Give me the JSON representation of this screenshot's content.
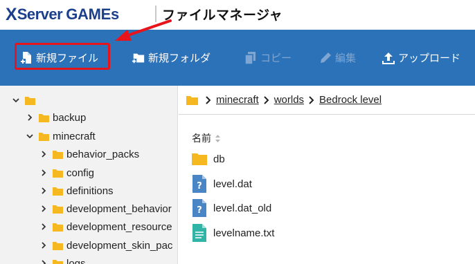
{
  "header": {
    "logo_x": "X",
    "logo_server": "Server",
    "logo_games": "GAMEs",
    "app_title": "ファイルマネージャ"
  },
  "toolbar": {
    "new_file": "新規ファイル",
    "new_folder": "新規フォルダ",
    "copy": "コピー",
    "edit": "編集",
    "upload": "アップロード"
  },
  "colors": {
    "brand": "#1c3f8c",
    "toolbar_bg": "#2c72b8",
    "highlight": "#e8141c",
    "folder": "#f5b820"
  },
  "tree": {
    "root_label": "",
    "items": [
      {
        "label": "backup",
        "expanded": false
      },
      {
        "label": "minecraft",
        "expanded": true
      },
      {
        "label": "behavior_packs",
        "expanded": false
      },
      {
        "label": "config",
        "expanded": false
      },
      {
        "label": "definitions",
        "expanded": false
      },
      {
        "label": "development_behavior",
        "expanded": false
      },
      {
        "label": "development_resource",
        "expanded": false
      },
      {
        "label": "development_skin_pac",
        "expanded": false
      },
      {
        "label": "logs",
        "expanded": false
      }
    ]
  },
  "breadcrumb": {
    "items": [
      "minecraft",
      "worlds",
      "Bedrock level"
    ]
  },
  "filelist": {
    "column_name": "名前",
    "files": [
      {
        "name": "db",
        "icon": "folder-icon"
      },
      {
        "name": "level.dat",
        "icon": "unknown-file-icon"
      },
      {
        "name": "level.dat_old",
        "icon": "unknown-file-icon"
      },
      {
        "name": "levelname.txt",
        "icon": "text-file-icon"
      }
    ]
  }
}
